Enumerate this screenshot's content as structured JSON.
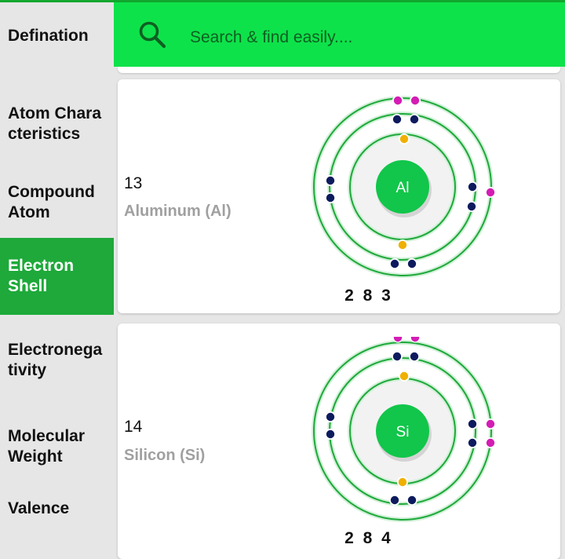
{
  "sidebar": {
    "items": [
      {
        "label": "Defination",
        "active": false
      },
      {
        "label": "Atom Chara\ncteristics",
        "active": false
      },
      {
        "label": "Compound\nAtom",
        "active": false
      },
      {
        "label": "Electron\nShell",
        "active": true
      },
      {
        "label": "Electronega\ntivity",
        "active": false
      },
      {
        "label": "Molecular\nWeight",
        "active": false
      },
      {
        "label": "Valence",
        "active": false
      }
    ]
  },
  "search": {
    "placeholder": "Search & find easily....",
    "icon": "search-icon"
  },
  "elements": [
    {
      "atomic_number": "13",
      "name": "Aluminum (Al)",
      "symbol": "Al",
      "configuration": "2 8 3"
    },
    {
      "atomic_number": "14",
      "name": "Silicon (Si)",
      "symbol": "Si",
      "configuration": "2 8 4"
    }
  ],
  "colors": {
    "accent": "#1ea93a",
    "search_bar": "#0ee24a",
    "orbit": "#1ea93a",
    "nucleus": "#11c64a",
    "electron_shell1": "#f0b000",
    "electron_shell2": "#0d1b5e",
    "electron_shell3": "#d41cb4"
  }
}
